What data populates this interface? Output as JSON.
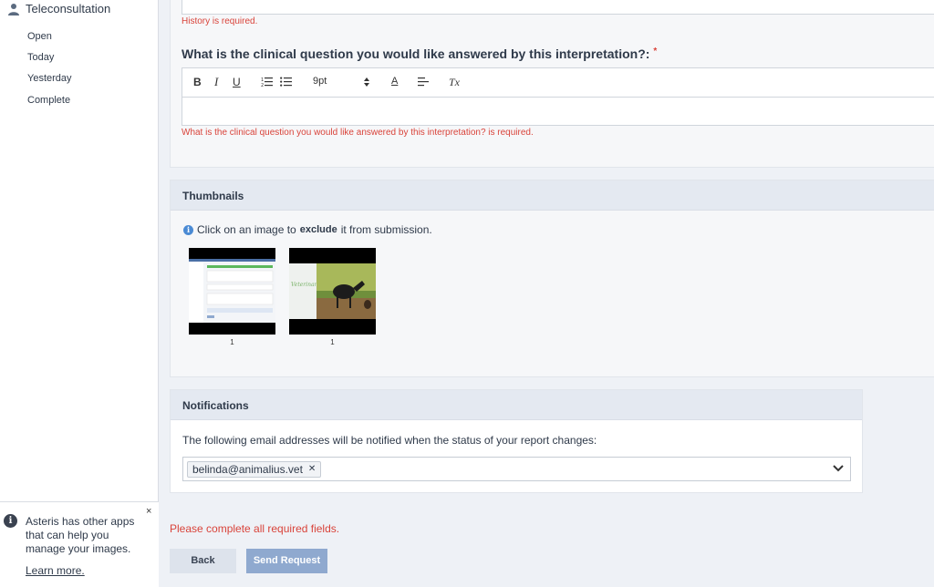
{
  "sidebar": {
    "title": "Teleconsultation",
    "items": [
      {
        "label": "Open"
      },
      {
        "label": "Today"
      },
      {
        "label": "Yesterday"
      },
      {
        "label": "Complete"
      }
    ],
    "promo": {
      "text": "Asteris has other apps that can help you manage your images.",
      "link": "Learn more.",
      "close": "×"
    }
  },
  "form": {
    "history_error": "History is required.",
    "question_label": "What is the clinical question you would like answered by this interpretation?:",
    "required_mark": "*",
    "toolbar": {
      "bold": "B",
      "italic": "I",
      "underline": "U",
      "font_size": "9pt",
      "color": "A",
      "clear": "Tx"
    },
    "question_error": "What is the clinical question you would like answered by this interpretation? is required."
  },
  "thumbnails": {
    "title": "Thumbnails",
    "hint_before": "Click on an image to",
    "hint_bold": "exclude",
    "hint_after": "it from submission.",
    "items": [
      {
        "caption": "1"
      },
      {
        "caption": "1"
      }
    ]
  },
  "notifications": {
    "title": "Notifications",
    "text": "The following email addresses will be notified when the status of your report changes:",
    "emails": [
      "belinda@animalius.vet"
    ]
  },
  "footer": {
    "error": "Please complete all required fields.",
    "back": "Back",
    "send": "Send Request"
  },
  "colors": {
    "accent": "#8fa9cf",
    "error": "#d9433a",
    "info": "#4a8ad4"
  }
}
